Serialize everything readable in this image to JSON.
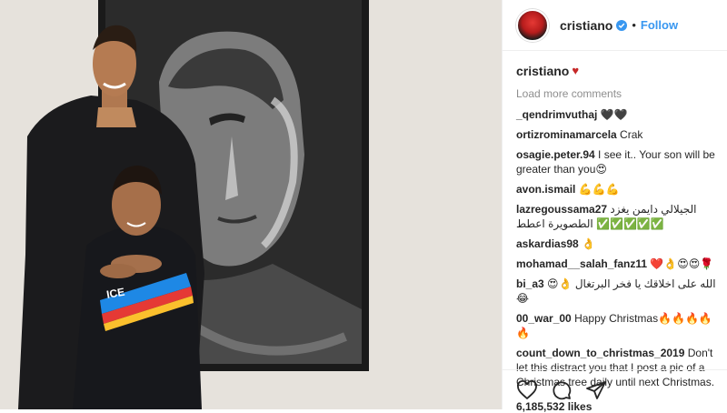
{
  "header": {
    "username": "cristiano",
    "separator": "•",
    "follow_label": "Follow"
  },
  "caption": {
    "username": "cristiano",
    "text": "♥"
  },
  "load_more_label": "Load more comments",
  "comments": [
    {
      "user": "_qendrimvuthaj",
      "text": " 🖤🖤"
    },
    {
      "user": "ortizrominamarcela",
      "text": " Crak"
    },
    {
      "user": "osagie.peter.94",
      "text": " I see it.. Your son will be greater than you😍"
    },
    {
      "user": "avon.ismail",
      "text": " 💪💪💪"
    },
    {
      "user": "lazregoussama27",
      "text": " الجيلالي دايمن يغزد الطصويرة اعطط ✅✅✅✅✅"
    },
    {
      "user": "askardias98",
      "text": " 👌"
    },
    {
      "user": "mohamad__salah_fanz11",
      "text": " ❤️👌😍😍🌹"
    },
    {
      "user": "bi_a3",
      "text": " 😍👌 الله على اخلاقك يا فخر البرتغال 😂"
    },
    {
      "user": "00_war_00",
      "text": " Happy Christmas🔥🔥🔥🔥🔥"
    },
    {
      "user": "count_down_to_christmas_2019",
      "text": " Don't let this distract you that I post a pic of a Christmas tree daily until next Christmas."
    }
  ],
  "likes_label": "6,185,532 likes",
  "colors": {
    "accent": "#3897f0",
    "text": "#262626",
    "muted": "#8e8e8e"
  }
}
